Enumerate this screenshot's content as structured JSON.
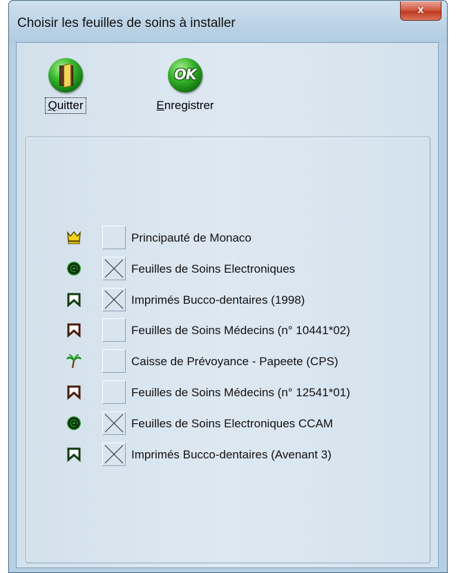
{
  "window": {
    "title": "Choisir les feuilles de soins à installer",
    "close_label": "x"
  },
  "toolbar": {
    "quit": {
      "label_accel": "Q",
      "label_rest": "uitter",
      "icon": "door-icon"
    },
    "save": {
      "label_accel": "E",
      "label_rest": "nregistrer",
      "icon": "ok-icon",
      "icon_text": "OK"
    }
  },
  "items": [
    {
      "label": "Principauté de Monaco",
      "checked": false,
      "icon": "crown-icon"
    },
    {
      "label": "Feuilles de Soins Electroniques",
      "checked": true,
      "icon": "at-sign-icon"
    },
    {
      "label": "Imprimés Bucco-dentaires (1998)",
      "checked": true,
      "icon": "tooth-icon"
    },
    {
      "label": "Feuilles de Soins Médecins (n° 10441*02)",
      "checked": false,
      "icon": "ribbon-icon"
    },
    {
      "label": "Caisse de Prévoyance - Papeete (CPS)",
      "checked": false,
      "icon": "palm-tree-icon"
    },
    {
      "label": "Feuilles de Soins Médecins (n° 12541*01)",
      "checked": false,
      "icon": "ribbon-icon"
    },
    {
      "label": "Feuilles de Soins Electroniques CCAM",
      "checked": true,
      "icon": "at-sign-icon"
    },
    {
      "label": "Imprimés Bucco-dentaires (Avenant 3)",
      "checked": true,
      "icon": "tooth-icon"
    }
  ]
}
